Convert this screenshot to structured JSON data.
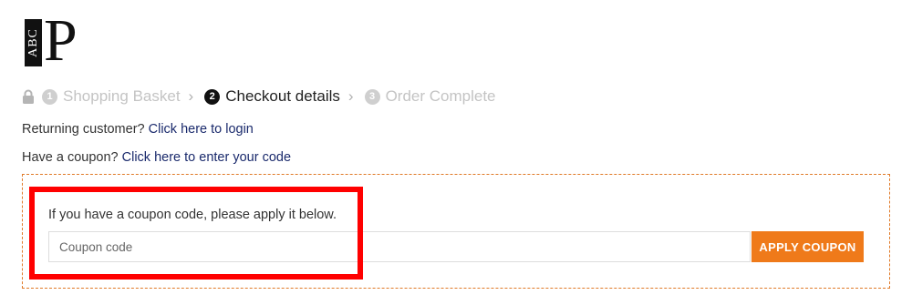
{
  "logo": {
    "box_text": "ABC",
    "letter": "P"
  },
  "steps": [
    {
      "number": "1",
      "label": "Shopping Basket",
      "state": "inactive"
    },
    {
      "number": "2",
      "label": "Checkout details",
      "state": "active"
    },
    {
      "number": "3",
      "label": "Order Complete",
      "state": "inactive"
    }
  ],
  "step_separator": "›",
  "returning_customer": {
    "text": "Returning customer?",
    "link": "Click here to login"
  },
  "coupon_notice": {
    "text": "Have a coupon?",
    "link": "Click here to enter your code"
  },
  "coupon_form": {
    "description": "If you have a coupon code, please apply it below.",
    "input_placeholder": "Coupon code",
    "input_value": "",
    "apply_label": "APPLY COUPON"
  },
  "colors": {
    "accent": "#ef7a1a",
    "border_dashed": "#e07a28",
    "link": "#1a2a6c",
    "highlight": "#ff0000"
  }
}
